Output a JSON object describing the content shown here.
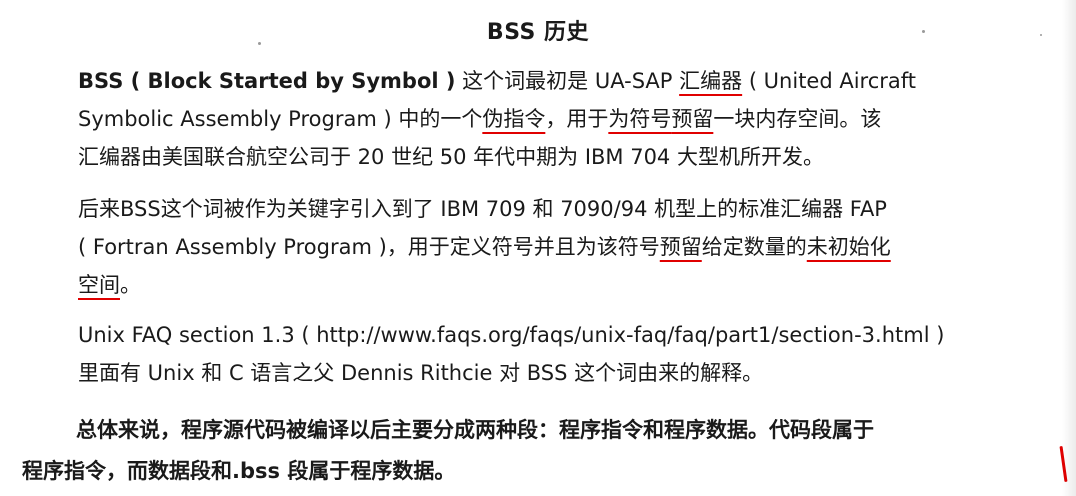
{
  "title": "BSS 历史",
  "paragraph1": {
    "line1": {
      "term": "BSS ( Block Started by Symbol )",
      "text_a": " 这个词最初是 UA-SAP ",
      "hl_assembler": "汇编器",
      "text_b": " ( United Aircraft"
    },
    "line2": {
      "text_a": "Symbolic Assembly Program ) 中的一个",
      "hl_pseudo": "伪指令",
      "text_b": "，用于",
      "hl_for_symbol": "为符号",
      "hl_reserve": "预留",
      "text_c": "一块内存空间。该"
    },
    "line3": "汇编器由美国联合航空公司于 20 世纪 50 年代中期为 IBM 704 大型机所开发。"
  },
  "paragraph2": {
    "line1": "后来BSS这个词被作为关键字引入到了 IBM 709 和 7090/94 机型上的标准汇编器 FAP",
    "line2": {
      "text_a": "( Fortran Assembly Program )，用于定义符号并且为该符号",
      "hl_reserve": "预留",
      "text_b": "给定数量的",
      "hl_uninit": "未初始化"
    },
    "line3": {
      "hl_space": "空间",
      "text_a": "。"
    }
  },
  "paragraph3": {
    "line1": "Unix FAQ section 1.3 ( http://www.faqs.org/faqs/unix-faq/faq/part1/section-3.html )",
    "line2": "里面有 Unix 和 C 语言之父 Dennis Rithcie 对 BSS 这个词由来的解释。"
  },
  "summary": {
    "line1": "总体来说，程序源代码被编译以后主要分成两种段：程序指令和程序数据。代码段属于",
    "line2": "程序指令，而数据段和.bss 段属于程序数据。"
  },
  "colors": {
    "text": "#1a1a1a",
    "underline": "#e00000",
    "background": "#ffffff"
  }
}
